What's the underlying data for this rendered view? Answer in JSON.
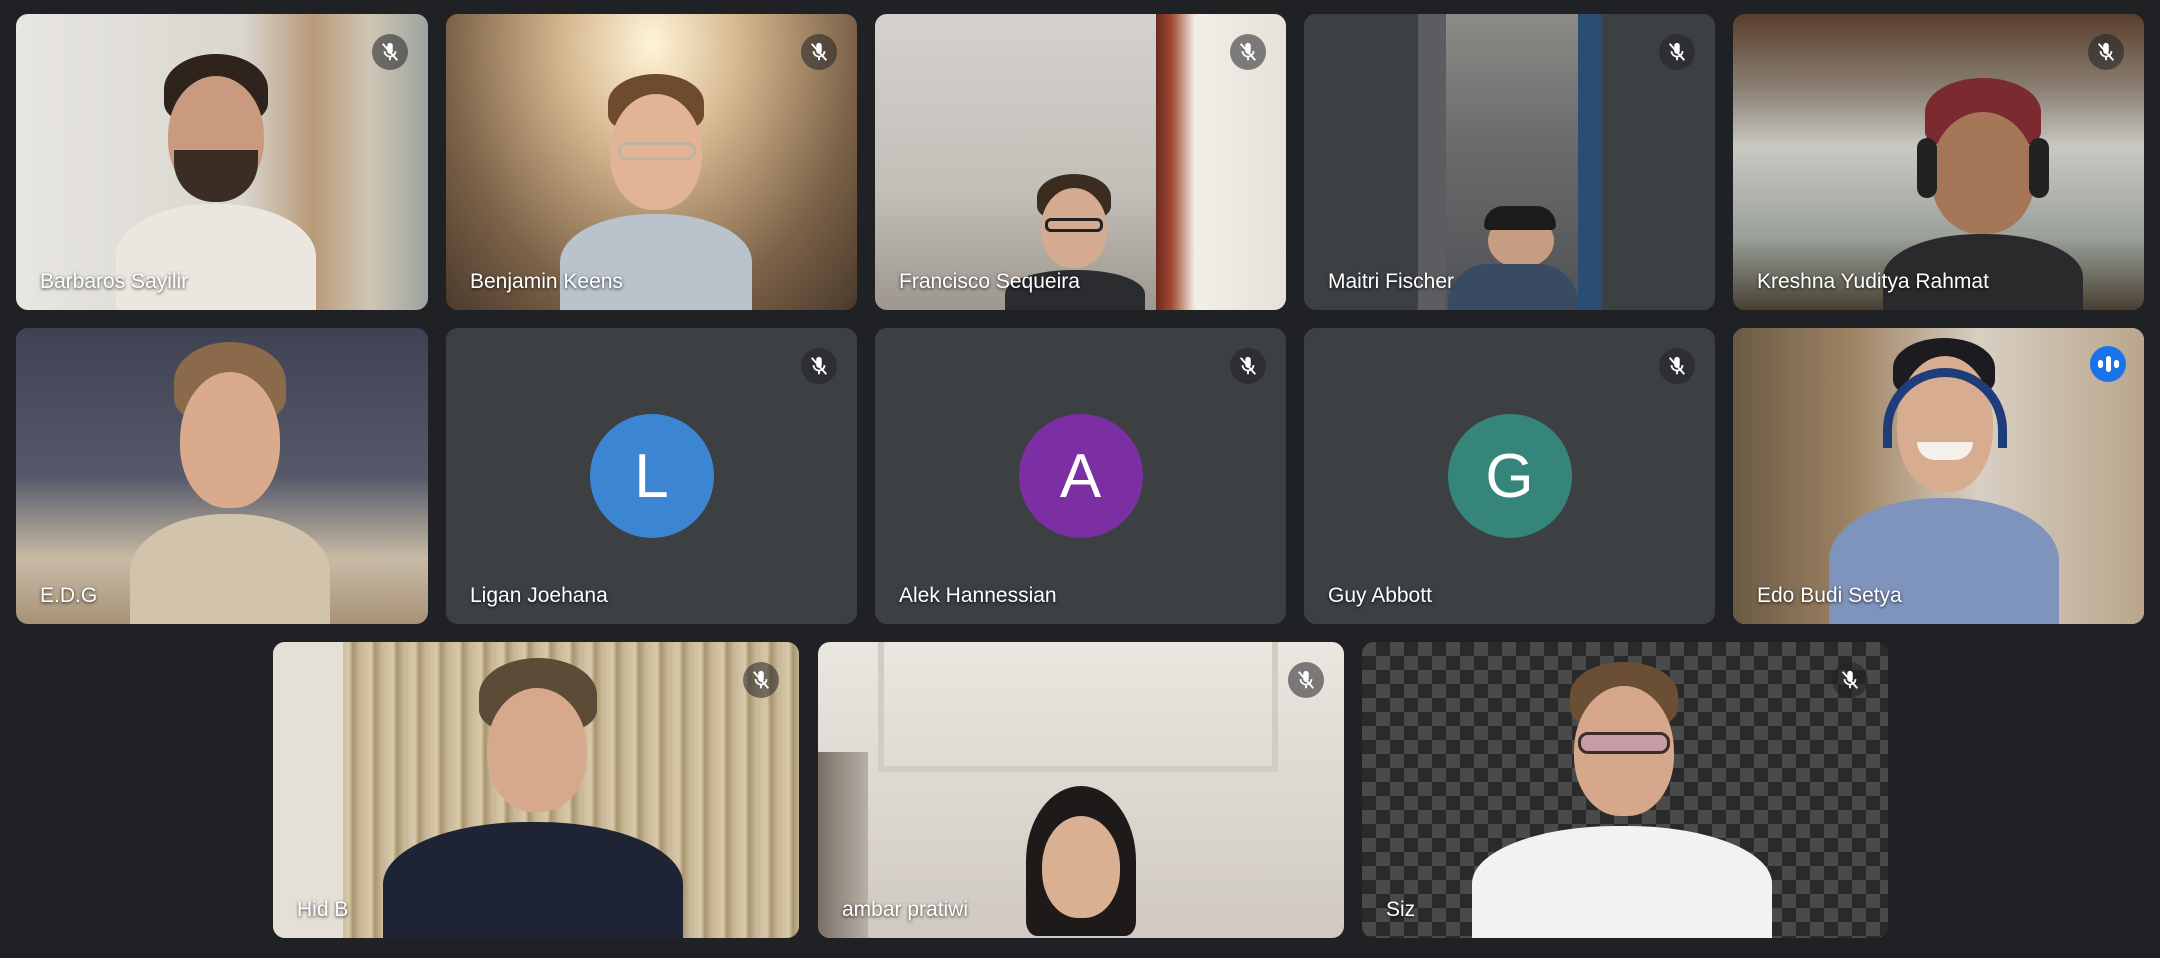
{
  "participants": [
    {
      "name": "Barbaros Sayilir",
      "muted": true
    },
    {
      "name": "Benjamin Keens",
      "muted": true
    },
    {
      "name": "Francisco Sequeira",
      "muted": true
    },
    {
      "name": "Maitri Fischer",
      "muted": true
    },
    {
      "name": "Kreshna Yuditya Rahmat",
      "muted": true
    },
    {
      "name": "E.D.G",
      "muted": false
    },
    {
      "name": "Ligan Joehana",
      "muted": true,
      "initial": "L",
      "avatar_color": "#3c85d2"
    },
    {
      "name": "Alek Hannessian",
      "muted": true,
      "initial": "A",
      "avatar_color": "#7c2ea3"
    },
    {
      "name": "Guy Abbott",
      "muted": true,
      "initial": "G",
      "avatar_color": "#36857a"
    },
    {
      "name": "Edo Budi Setya",
      "muted": false,
      "speaking": true
    },
    {
      "name": "Hid B",
      "muted": true
    },
    {
      "name": "ambar pratiwi",
      "muted": true
    },
    {
      "name": "Siz",
      "muted": true
    }
  ],
  "icons": {
    "mic_off": "mic-off-icon",
    "speaking": "speaking-indicator-icon"
  },
  "colors": {
    "background": "#202124",
    "tile": "#3c4043",
    "speaking_border": "#8ab4f8",
    "speaking_badge": "#1a73e8"
  }
}
